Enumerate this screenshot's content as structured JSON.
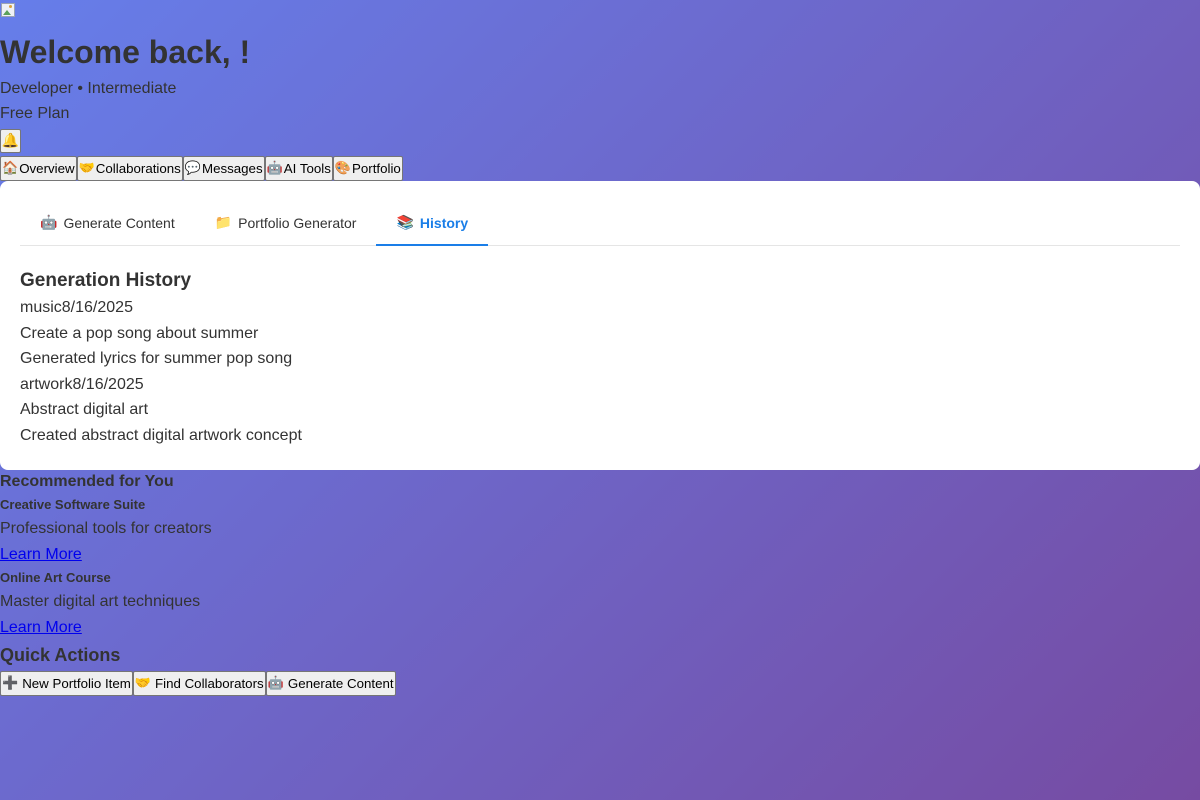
{
  "header": {
    "welcome": "Welcome back, !",
    "role_line": "Developer • Intermediate",
    "plan": "Free Plan",
    "notification_icon": "bell-icon",
    "notification_glyph": "🔔"
  },
  "nav": {
    "items": [
      {
        "label": "Overview",
        "icon": "house-icon",
        "glyph": "🏠"
      },
      {
        "label": "Collaborations",
        "icon": "handshake-icon",
        "glyph": "🤝"
      },
      {
        "label": "Messages",
        "icon": "speech-bubble-icon",
        "glyph": "💬"
      },
      {
        "label": "AI Tools",
        "icon": "robot-icon",
        "glyph": "🤖"
      },
      {
        "label": "Portfolio",
        "icon": "palette-icon",
        "glyph": "🎨"
      }
    ]
  },
  "ai_tools": {
    "tabs": [
      {
        "label": "Generate Content",
        "icon": "robot-icon",
        "glyph": "🤖",
        "active": false
      },
      {
        "label": "Portfolio Generator",
        "icon": "folder-icon",
        "glyph": "📁",
        "active": false
      },
      {
        "label": "History",
        "icon": "books-icon",
        "glyph": "📚",
        "active": true
      }
    ],
    "history": {
      "title": "Generation History",
      "entries": [
        {
          "type": "music",
          "date": "8/16/2025",
          "prompt": "Create a pop song about summer",
          "result": "Generated lyrics for summer pop song"
        },
        {
          "type": "artwork",
          "date": "8/16/2025",
          "prompt": "Abstract digital art",
          "result": "Created abstract digital artwork concept"
        }
      ]
    },
    "accent_color": "#1a7ee8"
  },
  "recommended": {
    "title": "Recommended for You",
    "items": [
      {
        "name": "Creative Software Suite",
        "description": "Professional tools for creators",
        "link": "Learn More"
      },
      {
        "name": "Online Art Course",
        "description": "Master digital art techniques",
        "link": "Learn More"
      }
    ]
  },
  "quick_actions": {
    "title": "Quick Actions",
    "buttons": [
      {
        "label": "New Portfolio Item",
        "icon": "plus-icon",
        "glyph": "➕"
      },
      {
        "label": "Find Collaborators",
        "icon": "handshake-icon",
        "glyph": "🤝"
      },
      {
        "label": "Generate Content",
        "icon": "robot-icon",
        "glyph": "🤖"
      }
    ]
  },
  "theme": {
    "gradient_start": "#667eea",
    "gradient_end": "#764ba2"
  }
}
